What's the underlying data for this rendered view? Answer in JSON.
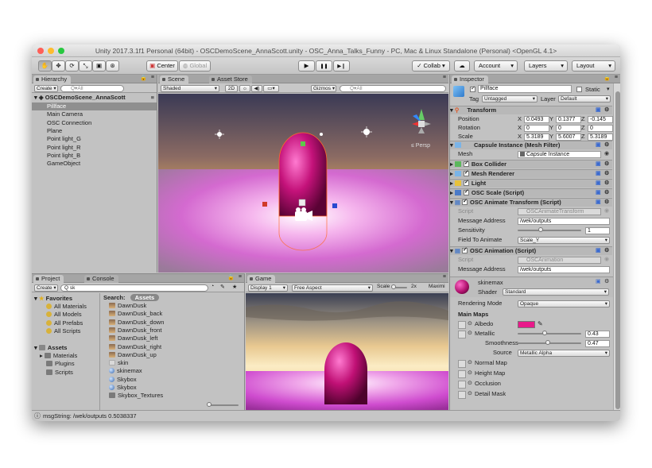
{
  "window": {
    "title": "Unity 2017.3.1f1 Personal (64bit) - OSCDemoScene_AnnaScott.unity - OSC_Anna_Talks_Funny - PC, Mac & Linux Standalone (Personal) <OpenGL 4.1>",
    "traffic_colors": [
      "#ff5f57",
      "#febc2e",
      "#28c840"
    ]
  },
  "toolbar": {
    "tools": [
      "hand-icon",
      "move-icon",
      "rotate-icon",
      "scale-icon",
      "rect-icon",
      "transform-icon"
    ],
    "pivot_label": "Center",
    "space_label": "Global",
    "play_glyph": "▶",
    "pause_glyph": "❚❚",
    "step_glyph": "▶❙",
    "collab_label": "Collab ▾",
    "account_label": "Account",
    "layers_label": "Layers",
    "layout_label": "Layout"
  },
  "hierarchy": {
    "tab": "Hierarchy",
    "create_label": "Create ▾",
    "search_placeholder": "Q▾All",
    "scene_name": "OSCDemoScene_AnnaScott",
    "items": [
      "Pillface",
      "Main Camera",
      "OSC Connection",
      "Plane",
      "Point light_G",
      "Point light_R",
      "Point light_B",
      "GameObject"
    ],
    "selected": "Pillface"
  },
  "scene": {
    "tab": "Scene",
    "store_tab": "Asset Store",
    "shading_mode": "Shaded",
    "mode_2d": "2D",
    "gizmos_label": "Gizmos ▾",
    "search_placeholder": "Q▾All",
    "persp_label": "≤ Persp"
  },
  "game": {
    "tab": "Game",
    "display_label": "Display 1",
    "aspect_label": "Free Aspect",
    "scale_label": "Scale",
    "scale_value": "2x",
    "maximize_label": "Maximi"
  },
  "project": {
    "tab": "Project",
    "console_tab": "Console",
    "create_label": "Create ▾",
    "search_value": "Q sk",
    "favorites_label": "Favorites",
    "favorites": [
      "All Materials",
      "All Models",
      "All Prefabs",
      "All Scripts"
    ],
    "assets_label": "Assets",
    "folders": [
      "Materials",
      "Plugins",
      "Scripts"
    ],
    "search_label": "Search:",
    "search_scope": "Assets",
    "results": [
      {
        "name": "DawnDusk",
        "kind": "texture"
      },
      {
        "name": "DawnDusk_back",
        "kind": "texture"
      },
      {
        "name": "DawnDusk_down",
        "kind": "texture"
      },
      {
        "name": "DawnDusk_front",
        "kind": "texture"
      },
      {
        "name": "DawnDusk_left",
        "kind": "texture"
      },
      {
        "name": "DawnDusk_right",
        "kind": "texture"
      },
      {
        "name": "DawnDusk_up",
        "kind": "texture"
      },
      {
        "name": "skin",
        "kind": "skin"
      },
      {
        "name": "skinemax",
        "kind": "material"
      },
      {
        "name": "Skybox",
        "kind": "material"
      },
      {
        "name": "Skybox",
        "kind": "material"
      },
      {
        "name": "Skybox_Textures",
        "kind": "folder"
      }
    ]
  },
  "inspector": {
    "tab": "Inspector",
    "object_name": "Pillface",
    "static_label": "Static",
    "tag_label": "Tag",
    "tag_value": "Untagged",
    "layer_label": "Layer",
    "layer_value": "Default",
    "transform": {
      "title": "Transform",
      "position_label": "Position",
      "rotation_label": "Rotation",
      "scale_label": "Scale",
      "position": [
        "0.0493",
        "0.1377",
        "-0.145"
      ],
      "rotation": [
        "0",
        "0",
        "0"
      ],
      "scale": [
        "5.3189",
        "5.6007",
        "5.3189"
      ]
    },
    "mesh_filter": {
      "title": "Capsule Instance (Mesh Filter)",
      "mesh_label": "Mesh",
      "mesh_value": "Capsule Instance"
    },
    "components": [
      "Box Collider",
      "Mesh Renderer",
      "Light",
      "OSC Scale (Script)"
    ],
    "animate_transform": {
      "title": "OSC Animate Transform (Script)",
      "script_label": "Script",
      "script_value": "OSCAnimateTransform",
      "address_label": "Message Address",
      "address_value": "/wek/outputs",
      "sensitivity_label": "Sensitivity",
      "sensitivity_value": "1",
      "field_label": "Field To Animate",
      "field_value": "Scale_Y"
    },
    "animation": {
      "title": "OSC Animation (Script)",
      "script_label": "Script",
      "script_value": "OSCAnimation",
      "address_label": "Message Address",
      "address_value": "/wek/outputs"
    },
    "material": {
      "name": "skinemax",
      "shader_label": "Shader",
      "shader_value": "Standard",
      "rendering_mode_label": "Rendering Mode",
      "rendering_mode_value": "Opaque",
      "main_maps_label": "Main Maps",
      "albedo_label": "Albedo",
      "albedo_color": "#e8198a",
      "metallic_label": "Metallic",
      "metallic_value": "0.43",
      "smoothness_label": "Smoothness",
      "smoothness_value": "0.47",
      "source_label": "Source",
      "source_value": "Metallic Alpha",
      "maps": [
        "Normal Map",
        "Height Map",
        "Occlusion",
        "Detail Mask"
      ]
    }
  },
  "status": {
    "message": "msgString: /wek/outputs 0.5038337"
  }
}
